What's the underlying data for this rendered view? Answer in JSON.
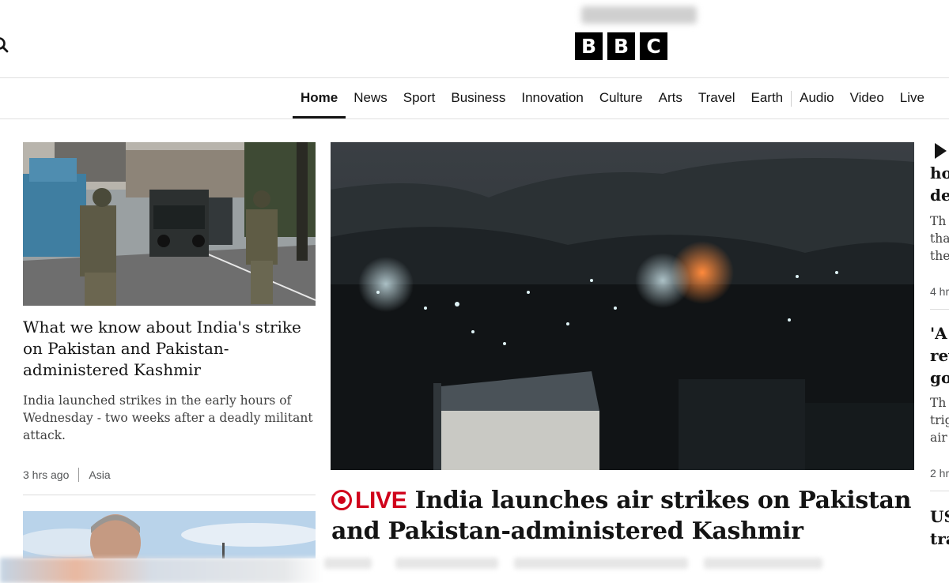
{
  "header": {
    "logo_letters": [
      "B",
      "B",
      "C"
    ]
  },
  "nav": {
    "items": [
      {
        "label": "Home",
        "active": true
      },
      {
        "label": "News"
      },
      {
        "label": "Sport"
      },
      {
        "label": "Business"
      },
      {
        "label": "Innovation"
      },
      {
        "label": "Culture"
      },
      {
        "label": "Arts"
      },
      {
        "label": "Travel"
      },
      {
        "label": "Earth"
      },
      {
        "label": "Audio"
      },
      {
        "label": "Video"
      },
      {
        "label": "Live"
      }
    ]
  },
  "left_story": {
    "headline": "What we know about India's strike on Pakistan and Pakistan-administered Kashmir",
    "summary": "India launched strikes in the early hours of Wednesday - two weeks after a deadly militant attack.",
    "time": "3 hrs ago",
    "section": "Asia"
  },
  "center_story": {
    "live_label": "LIVE",
    "headline": "India launches air strikes on Pakistan and Pakistan-administered Kashmir"
  },
  "right_column": {
    "story1": {
      "title_lines": [
        "ho",
        "de"
      ],
      "summary_lines": [
        "Th",
        "tha",
        "the"
      ],
      "time": "4 hr"
    },
    "story2": {
      "title_lines": [
        "'A",
        "rev",
        "go"
      ],
      "summary_lines": [
        "Th",
        "trig",
        "air"
      ],
      "time": "2 hr"
    },
    "story3": {
      "title_lines": [
        "US",
        "tra"
      ]
    }
  },
  "colors": {
    "live_red": "#d0021b",
    "text": "#141414",
    "muted": "#545658"
  }
}
